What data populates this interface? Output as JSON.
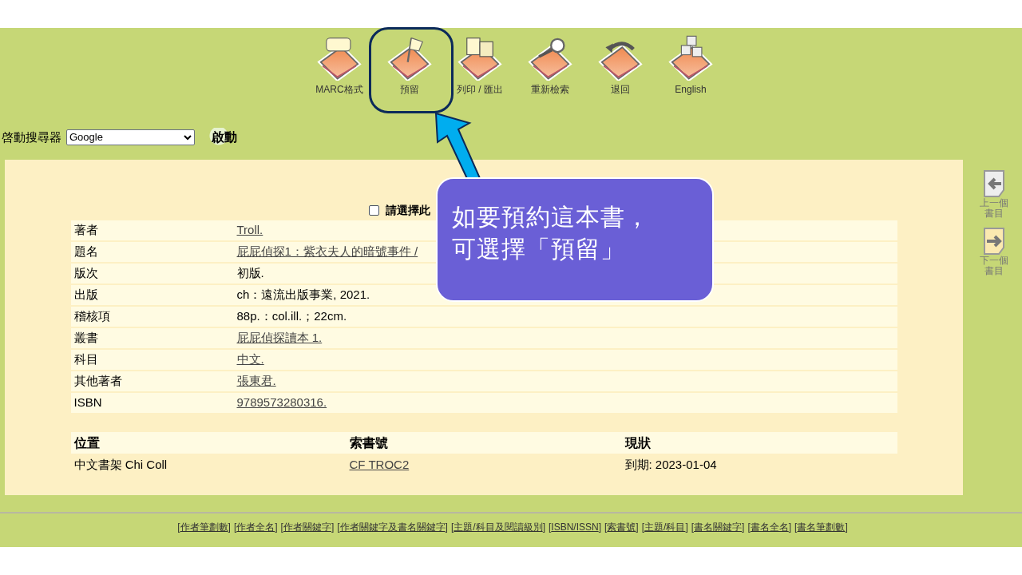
{
  "toolbar": [
    {
      "label": "MARC格式"
    },
    {
      "label": "預留"
    },
    {
      "label": "列印 / 匯出"
    },
    {
      "label": "重新檢索"
    },
    {
      "label": "退回"
    },
    {
      "label": "English"
    }
  ],
  "search_engine": {
    "label": "啓動搜尋器",
    "value": "Google",
    "button": "啟動"
  },
  "select_option": {
    "label": "請選擇此",
    "checked": false
  },
  "record": [
    {
      "label": "著者",
      "value": "Troll.",
      "link": true
    },
    {
      "label": "題名",
      "value": "屁屁偵探1：紫衣夫人的暗號事件 /",
      "link": true
    },
    {
      "label": "版次",
      "value": "初版.",
      "link": false
    },
    {
      "label": "出版",
      "value": "ch：遠流出版事業, 2021.",
      "link": false
    },
    {
      "label": "稽核項",
      "value": "88p.：col.ill.；22cm.",
      "link": false
    },
    {
      "label": "叢書",
      "value": "屁屁偵探讀本 1.",
      "link": true
    },
    {
      "label": "科目",
      "value": "中文.",
      "link": true
    },
    {
      "label": "其他著者",
      "value": "張東君.",
      "link": true
    },
    {
      "label": "ISBN",
      "value": "9789573280316.",
      "link": true
    }
  ],
  "holdings": {
    "columns": [
      "位置",
      "索書號",
      "現狀"
    ],
    "rows": [
      [
        {
          "text": "中文書架 Chi Coll",
          "link": false
        },
        {
          "text": "CF TROC2",
          "link": true
        },
        {
          "text": "到期: 2023-01-04",
          "link": false
        }
      ]
    ]
  },
  "side_nav": [
    {
      "label": "上一個書目"
    },
    {
      "label": "下一個書目"
    }
  ],
  "footer_links": [
    "作者筆劃數",
    "作者全名",
    "作者關鍵字",
    "作者關鍵字及書名關鍵字",
    "主題/科目及閱讀級別",
    "ISBN/ISSN",
    "索書號",
    "主題/科目",
    "書名關鍵字",
    "書名全名",
    "書名筆劃數"
  ],
  "footer_brackets": [
    "[",
    "]"
  ],
  "callout": {
    "text": "如要預約這本書，可選擇「預留」"
  }
}
